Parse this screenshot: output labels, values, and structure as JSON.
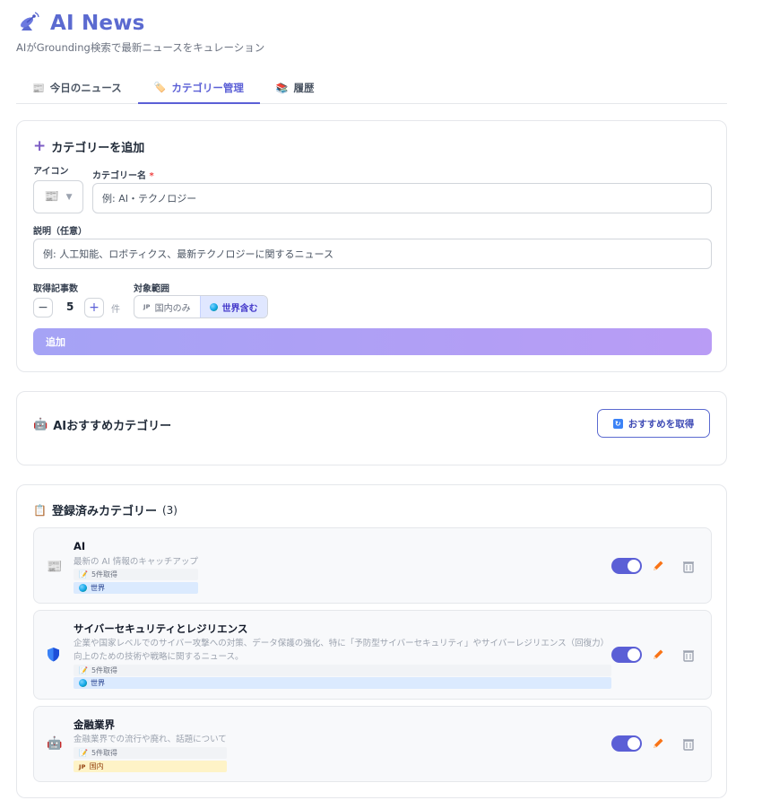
{
  "app": {
    "title": "AI News",
    "subtitle": "AIがGrounding検索で最新ニュースをキュレーション"
  },
  "tabs": [
    {
      "label": "今日のニュース",
      "icon": "newspaper-icon"
    },
    {
      "label": "カテゴリー管理",
      "icon": "tag-icon",
      "active": true
    },
    {
      "label": "履歴",
      "icon": "books-icon"
    }
  ],
  "add_form": {
    "title": "カテゴリーを追加",
    "icon_label": "アイコン",
    "name_label": "カテゴリー名",
    "required_mark": "*",
    "name_placeholder": "例: AI・テクノロジー",
    "desc_label": "説明（任意）",
    "desc_placeholder": "例: 人工知能、ロボティクス、最新テクノロジーに関するニュース",
    "count_label": "取得記事数",
    "minus": "−",
    "count_value": "5",
    "plus": "+",
    "unit": "件",
    "scope_label": "対象範囲",
    "scope_domestic_tag": "JP",
    "scope_domestic": "国内のみ",
    "scope_world": "世界含む",
    "submit": "追加"
  },
  "recommend": {
    "title": "AIおすすめカテゴリー",
    "button": "おすすめを取得"
  },
  "registered": {
    "title": "登録済みカテゴリー",
    "count": "(3)",
    "items": [
      {
        "name": "AI",
        "desc": "最新の AI 情報のキャッチアップ",
        "fetch": "5件取得",
        "scope": "世界",
        "scope_type": "world",
        "icon": "newspaper-icon",
        "enabled": true
      },
      {
        "name": "サイバーセキュリティとレジリエンス",
        "desc": "企業や国家レベルでのサイバー攻撃への対策、データ保護の強化、特に「予防型サイバーセキュリティ」やサイバーレジリエンス（回復力）向上のための技術や戦略に関するニュース。",
        "fetch": "5件取得",
        "scope": "世界",
        "scope_type": "world",
        "icon": "shield-icon",
        "enabled": true
      },
      {
        "name": "金融業界",
        "desc": "金融業界での流行や廃れ、話題について",
        "fetch": "5件取得",
        "scope": "国内",
        "scope_tag": "JP",
        "scope_type": "domestic",
        "icon": "robot-icon",
        "enabled": true
      }
    ]
  },
  "colors": {
    "accent": "#5b5fd6",
    "title": "#5b6ad0",
    "edit": "#f97316"
  }
}
